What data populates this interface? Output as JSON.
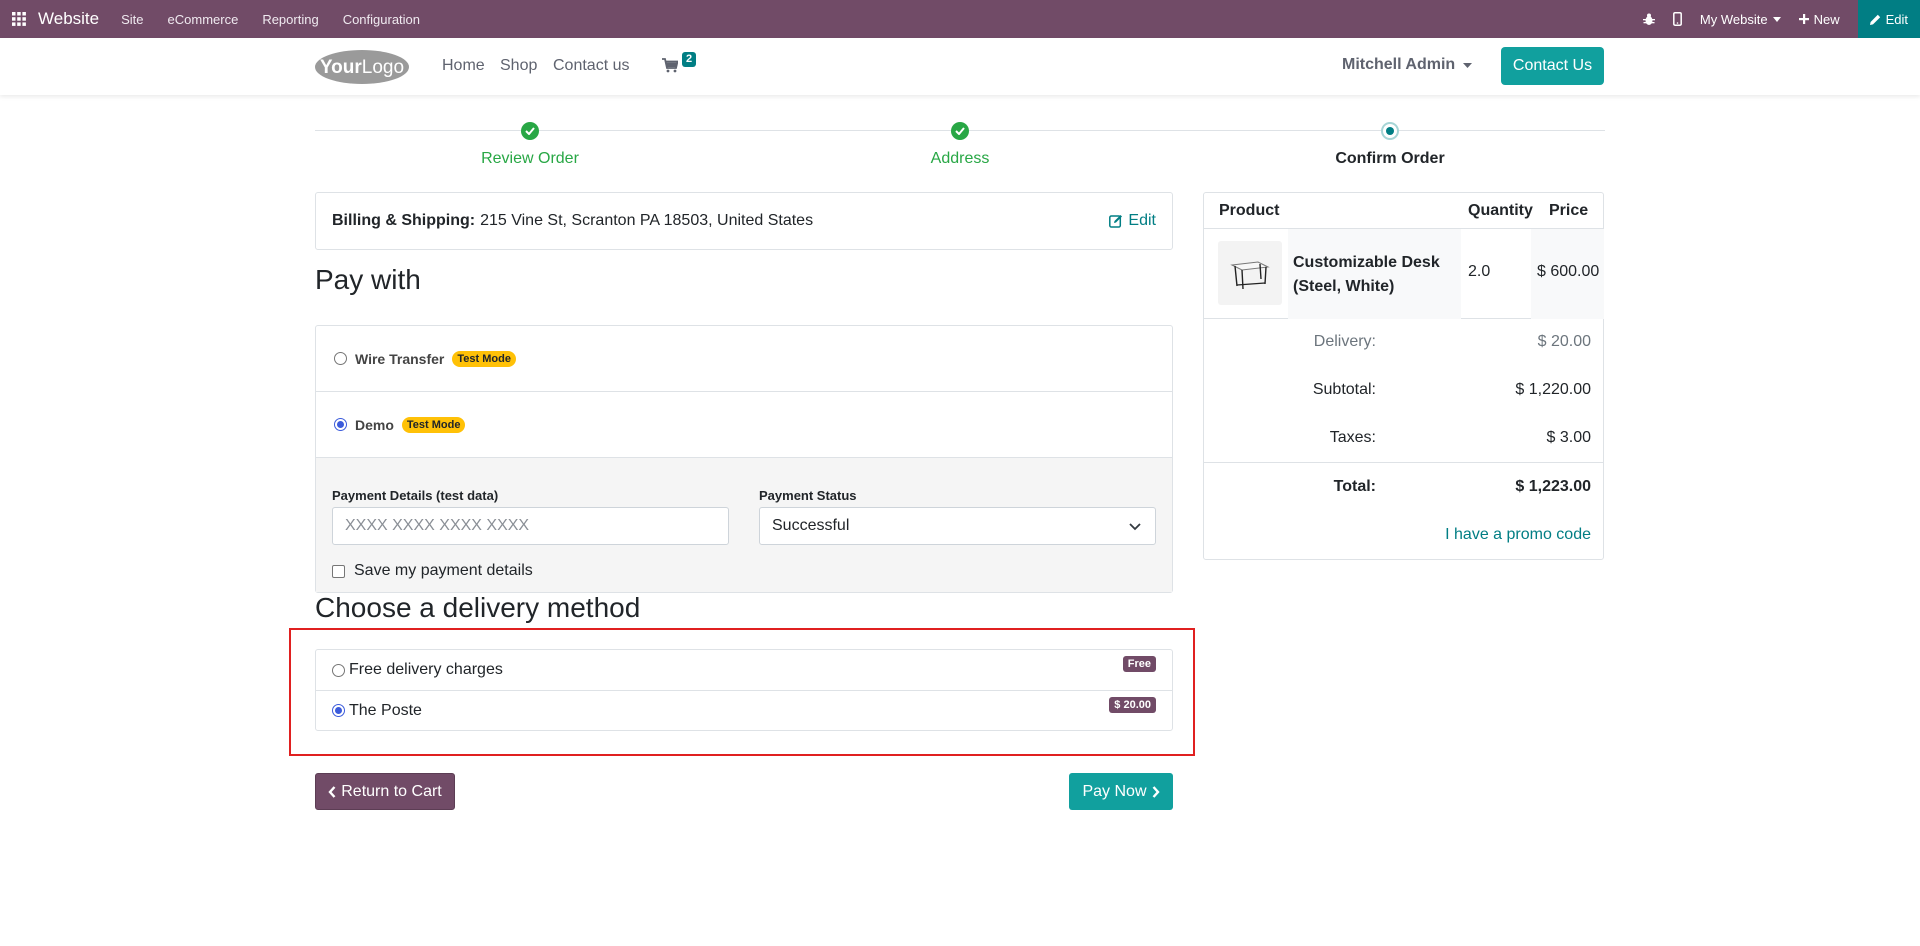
{
  "adminbar": {
    "brand": "Website",
    "menu": [
      "Site",
      "eCommerce",
      "Reporting",
      "Configuration"
    ],
    "my_website": "My Website",
    "new_label": "New",
    "edit_label": "Edit"
  },
  "header": {
    "logo_text": "YourLogo",
    "nav": [
      "Home",
      "Shop",
      "Contact us"
    ],
    "cart_count": "2",
    "user": "Mitchell Admin",
    "contact_button": "Contact Us"
  },
  "steps": [
    {
      "label": "Review Order",
      "state": "done"
    },
    {
      "label": "Address",
      "state": "done"
    },
    {
      "label": "Confirm Order",
      "state": "current"
    }
  ],
  "billing": {
    "label": "Billing & Shipping:",
    "address": "215 Vine St, Scranton PA 18503, United States",
    "edit_label": "Edit"
  },
  "pay": {
    "title": "Pay with",
    "options": [
      {
        "name": "Wire Transfer",
        "badge": "Test Mode",
        "selected": false
      },
      {
        "name": "Demo",
        "badge": "Test Mode",
        "selected": true
      }
    ],
    "details_label": "Payment Details (test data)",
    "details_placeholder": "XXXX XXXX XXXX XXXX",
    "status_label": "Payment Status",
    "status_value": "Successful",
    "save_label": "Save my payment details"
  },
  "delivery": {
    "title": "Choose a delivery method",
    "options": [
      {
        "name": "Free delivery charges",
        "price": "Free",
        "selected": false
      },
      {
        "name": "The Poste",
        "price": "$ 20.00",
        "selected": true
      }
    ]
  },
  "buttons": {
    "back": "Return to Cart",
    "pay": "Pay Now"
  },
  "summary": {
    "headers": {
      "product": "Product",
      "quantity": "Quantity",
      "price": "Price"
    },
    "product": {
      "name_line1": "Customizable Desk",
      "name_line2": "(Steel, White)",
      "quantity": "2.0",
      "price": "$ 600.00"
    },
    "delivery_label": "Delivery:",
    "delivery_value": "$ 20.00",
    "subtotal_label": "Subtotal:",
    "subtotal_value": "$ 1,220.00",
    "taxes_label": "Taxes:",
    "taxes_value": "$ 3.00",
    "total_label": "Total:",
    "total_value": "$ 1,223.00",
    "promo": "I have a promo code"
  },
  "colors": {
    "admin_bar": "#714b67",
    "accent": "#11a09e",
    "success": "#28a745",
    "highlight_border": "#e02020"
  }
}
